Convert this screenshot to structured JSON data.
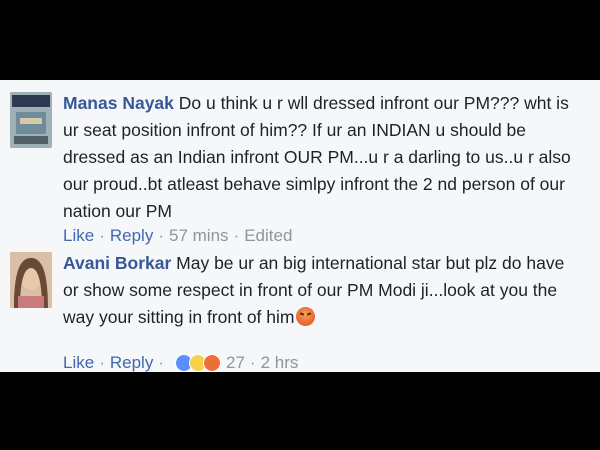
{
  "comments": [
    {
      "author": "Manas Nayak",
      "text": "Do u think u r wll dressed infront our PM??? wht is ur seat position infront of him?? If ur an INDIAN u should be dressed as an Indian infront OUR PM...u r a darling to us..u r also our proud..bt atleast behave simlpy infront the 2 nd person of our nation our PM",
      "like_label": "Like",
      "reply_label": "Reply",
      "time": "57 mins",
      "edited_label": "Edited"
    },
    {
      "author": "Avani Borkar",
      "text": "May be ur an big international star but plz do have or show some respect in front of our PM Modi ji...look at you the way your sitting in front of him",
      "like_label": "Like",
      "reply_label": "Reply",
      "reaction_count": "27",
      "time": "2 hrs",
      "reactions": [
        "like-icon",
        "haha-icon",
        "angry-icon"
      ]
    }
  ],
  "separator": "·"
}
